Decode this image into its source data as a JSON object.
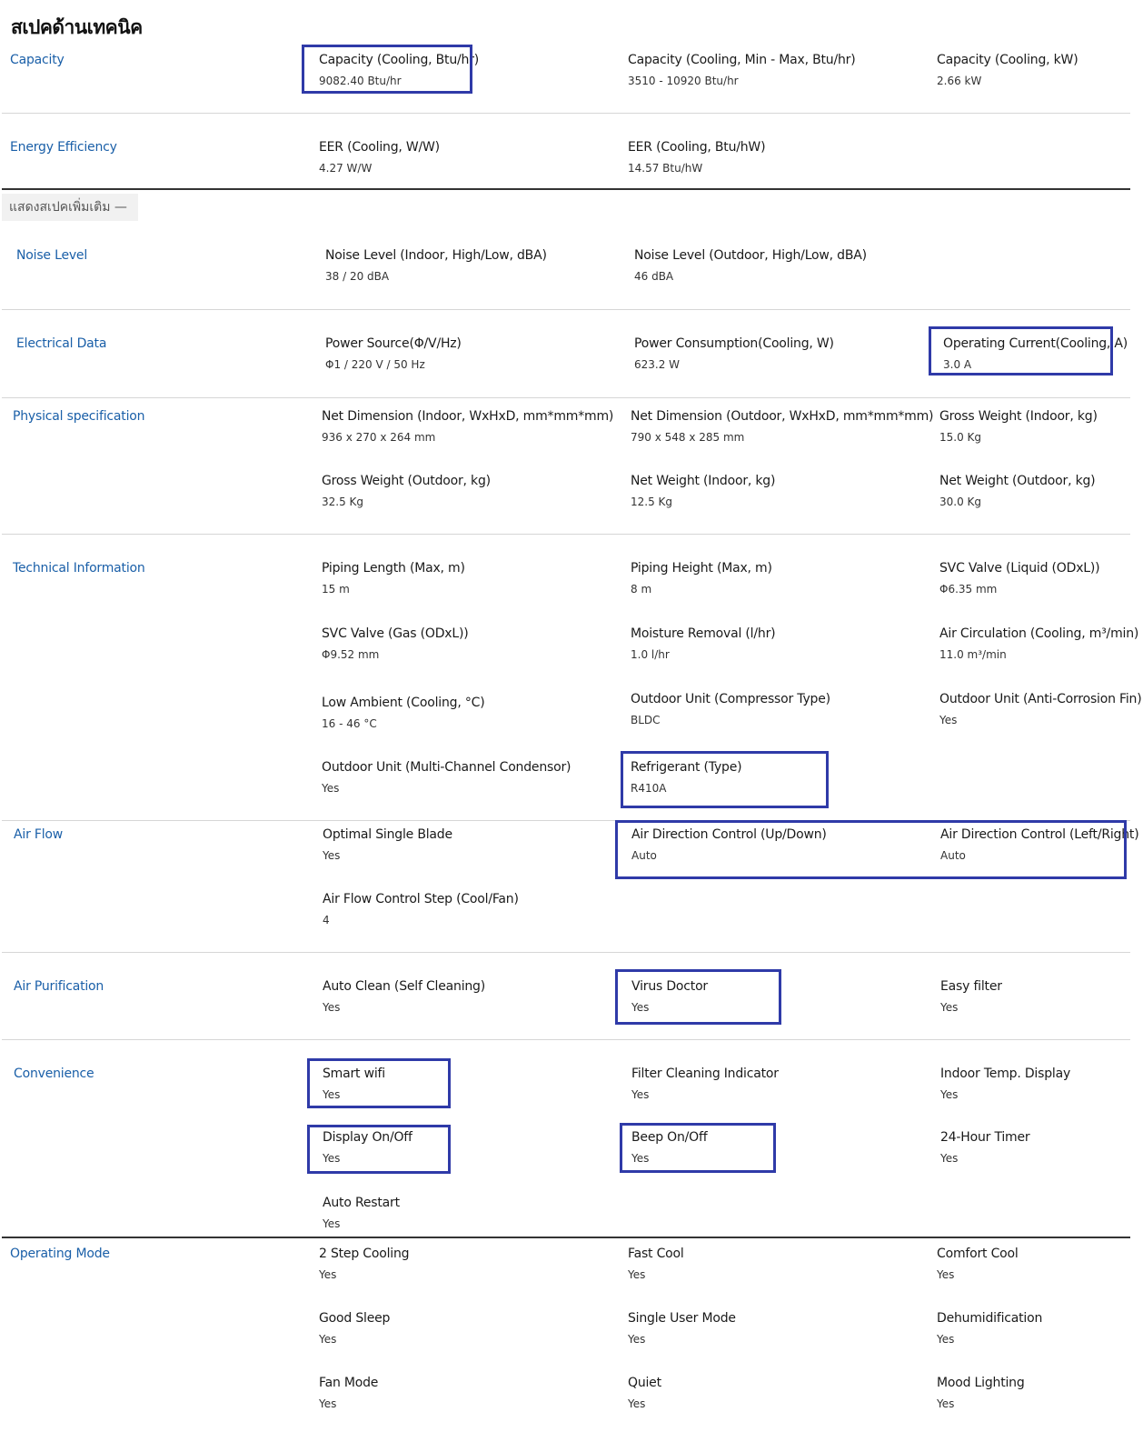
{
  "page_title": "สเปคด้านเทคนิค",
  "more_specs_label": "แสดงสเปคเพิ่มเติม",
  "more_specs_icon": "minus-icon",
  "highlight_color": "#2f3aa8",
  "section_color": "#1a5fa8",
  "sections": {
    "capacity": {
      "label": "Capacity",
      "items": [
        {
          "label": "Capacity (Cooling, Btu/hr)",
          "value": "9082.40 Btu/hr"
        },
        {
          "label": "Capacity (Cooling, Min - Max, Btu/hr)",
          "value": "3510 - 10920 Btu/hr"
        },
        {
          "label": "Capacity (Cooling, kW)",
          "value": "2.66 kW"
        }
      ]
    },
    "energy": {
      "label": "Energy Efficiency",
      "items": [
        {
          "label": "EER (Cooling, W/W)",
          "value": "4.27 W/W"
        },
        {
          "label": "EER (Cooling, Btu/hW)",
          "value": "14.57 Btu/hW"
        }
      ]
    },
    "noise": {
      "label": "Noise Level",
      "items": [
        {
          "label": "Noise Level (Indoor, High/Low, dBA)",
          "value": "38 / 20 dBA"
        },
        {
          "label": "Noise Level (Outdoor, High/Low, dBA)",
          "value": "46 dBA"
        }
      ]
    },
    "electrical": {
      "label": "Electrical Data",
      "items": [
        {
          "label": "Power Source(Φ/V/Hz)",
          "value": "Φ1 / 220 V / 50 Hz"
        },
        {
          "label": "Power Consumption(Cooling, W)",
          "value": "623.2 W"
        },
        {
          "label": "Operating Current(Cooling, A)",
          "value": "3.0 A"
        }
      ]
    },
    "physical": {
      "label": "Physical specification",
      "items": [
        {
          "label": "Net Dimension (Indoor, WxHxD, mm*mm*mm)",
          "value": "936 x 270 x 264 mm"
        },
        {
          "label": "Net Dimension (Outdoor, WxHxD, mm*mm*mm)",
          "value": "790 x 548 x 285 mm"
        },
        {
          "label": "Gross Weight (Indoor, kg)",
          "value": "15.0 Kg"
        },
        {
          "label": "Gross Weight (Outdoor, kg)",
          "value": "32.5 Kg"
        },
        {
          "label": "Net Weight (Indoor, kg)",
          "value": "12.5 Kg"
        },
        {
          "label": "Net Weight (Outdoor, kg)",
          "value": "30.0 Kg"
        }
      ]
    },
    "technical": {
      "label": "Technical Information",
      "items": [
        {
          "label": "Piping Length (Max, m)",
          "value": "15 m"
        },
        {
          "label": "Piping Height (Max, m)",
          "value": "8 m"
        },
        {
          "label": "SVC Valve (Liquid (ODxL))",
          "value": "Φ6.35 mm"
        },
        {
          "label": "SVC Valve (Gas (ODxL))",
          "value": "Φ9.52 mm"
        },
        {
          "label": "Moisture Removal (l/hr)",
          "value": "1.0 l/hr"
        },
        {
          "label": "Air Circulation (Cooling, m³/min)",
          "value": "11.0 m³/min"
        },
        {
          "label": "Low Ambient (Cooling, °C)",
          "value": "16 - 46 °C"
        },
        {
          "label": "Outdoor Unit (Compressor Type)",
          "value": "BLDC"
        },
        {
          "label": "Outdoor Unit (Anti-Corrosion Fin)",
          "value": "Yes"
        },
        {
          "label": "Outdoor Unit (Multi-Channel Condensor)",
          "value": "Yes"
        },
        {
          "label": "Refrigerant (Type)",
          "value": "R410A"
        }
      ]
    },
    "airflow": {
      "label": "Air Flow",
      "items": [
        {
          "label": "Optimal Single Blade",
          "value": "Yes"
        },
        {
          "label": "Air Direction Control (Up/Down)",
          "value": "Auto"
        },
        {
          "label": "Air Direction Control (Left/Right)",
          "value": "Auto"
        },
        {
          "label": "Air Flow Control Step (Cool/Fan)",
          "value": "4"
        }
      ]
    },
    "purification": {
      "label": "Air Purification",
      "items": [
        {
          "label": "Auto Clean (Self Cleaning)",
          "value": "Yes"
        },
        {
          "label": "Virus Doctor",
          "value": "Yes"
        },
        {
          "label": "Easy filter",
          "value": "Yes"
        }
      ]
    },
    "convenience": {
      "label": "Convenience",
      "items": [
        {
          "label": "Smart wifi",
          "value": "Yes"
        },
        {
          "label": "Filter Cleaning Indicator",
          "value": "Yes"
        },
        {
          "label": "Indoor Temp. Display",
          "value": "Yes"
        },
        {
          "label": "Display On/Off",
          "value": "Yes"
        },
        {
          "label": "Beep On/Off",
          "value": "Yes"
        },
        {
          "label": "24-Hour Timer",
          "value": "Yes"
        },
        {
          "label": "Auto Restart",
          "value": "Yes"
        }
      ]
    },
    "operating": {
      "label": "Operating Mode",
      "items": [
        {
          "label": "2 Step Cooling",
          "value": "Yes"
        },
        {
          "label": "Fast Cool",
          "value": "Yes"
        },
        {
          "label": "Comfort Cool",
          "value": "Yes"
        },
        {
          "label": "Good Sleep",
          "value": "Yes"
        },
        {
          "label": "Single User Mode",
          "value": "Yes"
        },
        {
          "label": "Dehumidification",
          "value": "Yes"
        },
        {
          "label": "Fan Mode",
          "value": "Yes"
        },
        {
          "label": "Quiet",
          "value": "Yes"
        },
        {
          "label": "Mood Lighting",
          "value": "Yes"
        }
      ]
    }
  }
}
